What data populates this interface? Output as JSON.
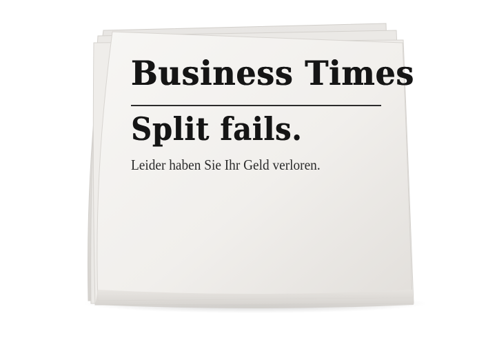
{
  "newspaper": {
    "masthead": "Business Times",
    "headline": "Split fails.",
    "subline": "Leider haben Sie Ihr Geld verloren."
  },
  "colors": {
    "paper": "#f1efec",
    "ink": "#151515",
    "background": "#ffffff"
  }
}
